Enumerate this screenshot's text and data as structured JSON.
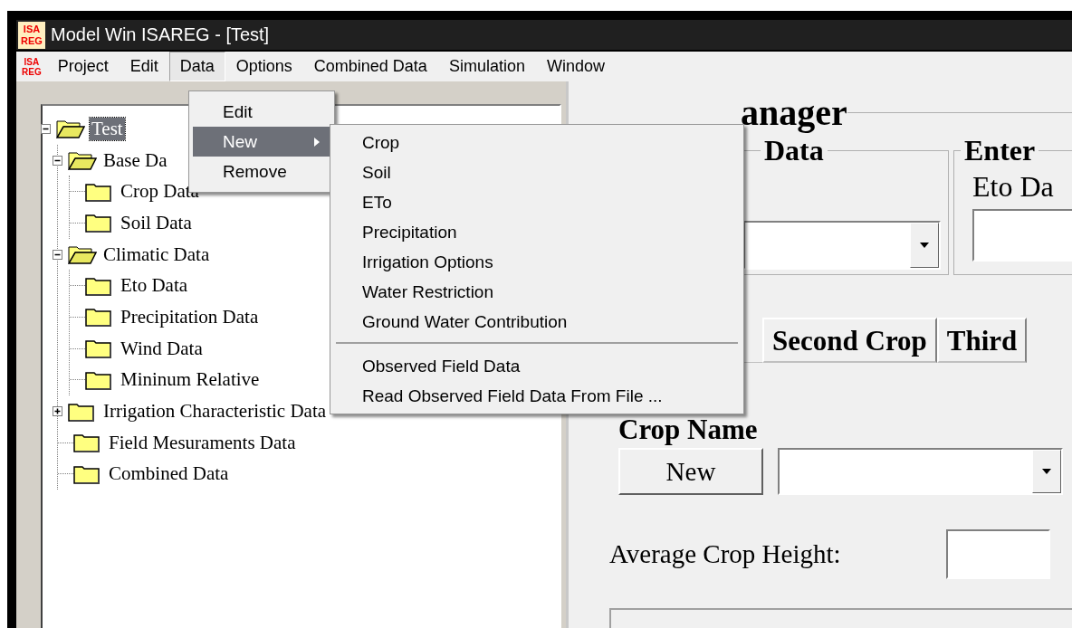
{
  "window": {
    "logo": [
      "ISA",
      "REG"
    ],
    "title": "Model Win ISAREG - [Test]"
  },
  "menu_logo": [
    "ISA",
    "REG"
  ],
  "menu_bar": [
    {
      "label": "Project",
      "selected": false
    },
    {
      "label": "Edit",
      "selected": false
    },
    {
      "label": "Data",
      "selected": true
    },
    {
      "label": "Options",
      "selected": false
    },
    {
      "label": "Combined Data",
      "selected": false
    },
    {
      "label": "Simulation",
      "selected": false
    },
    {
      "label": "Window",
      "selected": false
    }
  ],
  "data_menu": [
    {
      "label": "Edit",
      "selected": false,
      "submenu": false
    },
    {
      "label": "New",
      "selected": true,
      "submenu": true
    },
    {
      "label": "Remove",
      "selected": false,
      "submenu": false
    }
  ],
  "new_submenu": [
    {
      "kind": "item",
      "label": "Crop"
    },
    {
      "kind": "item",
      "label": "Soil"
    },
    {
      "kind": "item",
      "label": "ETo"
    },
    {
      "kind": "item",
      "label": "Precipitation"
    },
    {
      "kind": "item",
      "label": "Irrigation Options"
    },
    {
      "kind": "item",
      "label": "Water Restriction"
    },
    {
      "kind": "item",
      "label": "Ground Water Contribution"
    },
    {
      "kind": "separator"
    },
    {
      "kind": "item",
      "label": "Observed Field Data"
    },
    {
      "kind": "item",
      "label": "Read Observed Field Data From File ..."
    }
  ],
  "tree": {
    "label": "Test",
    "selected": true,
    "expanded": true,
    "children": [
      {
        "label": "Base Da",
        "selected": false,
        "expanded": true,
        "children": [
          {
            "label": "Crop Data",
            "selected": false
          },
          {
            "label": "Soil Data",
            "selected": false
          }
        ]
      },
      {
        "label": "Climatic Data",
        "selected": false,
        "expanded": true,
        "children": [
          {
            "label": "Eto Data",
            "selected": false
          },
          {
            "label": "Precipitation Data",
            "selected": false
          },
          {
            "label": "Wind Data",
            "selected": false
          },
          {
            "label": "Mininum Relative",
            "selected": false
          }
        ]
      },
      {
        "label": "Irrigation Characteristic Data",
        "selected": false,
        "expanded": false
      },
      {
        "label": "Field Mesuraments Data",
        "selected": false
      },
      {
        "label": "Combined Data",
        "selected": false
      }
    ]
  },
  "data_manager": {
    "title": "anager",
    "groups": [
      {
        "legend": "Data",
        "field": {
          "kind": "combo"
        }
      },
      {
        "legend": "Enter",
        "label": "Eto Da",
        "field": {
          "kind": "text"
        }
      }
    ],
    "tabs": [
      {
        "label": "Second Crop",
        "selected": false
      },
      {
        "label": "Third",
        "selected": false
      }
    ],
    "crop_name_label": "Crop Name",
    "new_button": "New",
    "crop_height_label": "Average Crop Height:"
  }
}
